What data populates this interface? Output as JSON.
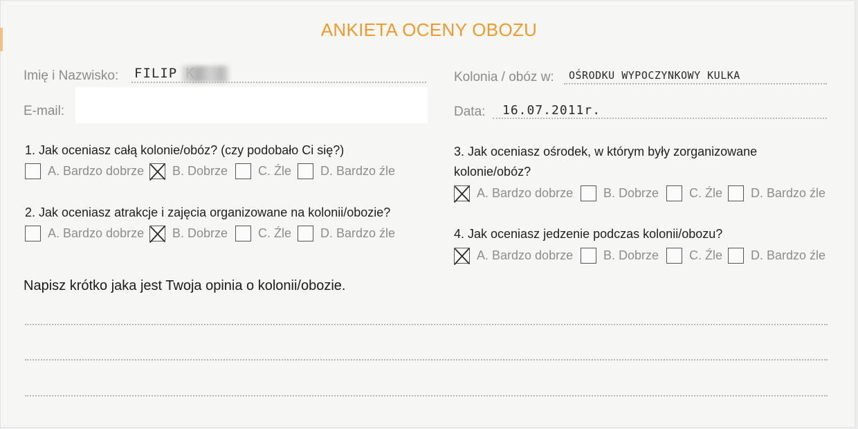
{
  "form": {
    "title": "ANKIETA OCENY OBOZU",
    "name_label": "Imię i Nazwisko:",
    "name_value": "FILIP K",
    "email_label": "E-mail:",
    "camp_label": "Kolonia / obóz w:",
    "camp_value": "OŚRODKU WYPOCZYNKOWY KULKA",
    "date_label": "Data:",
    "date_value": "16.07.2011r.",
    "options": [
      "A. Bardzo dobrze",
      "B. Dobrze",
      "C. Źle",
      "D. Bardzo źle"
    ],
    "questions": [
      {
        "text": "1. Jak oceniasz całą kolonie/obóz? (czy podobało Ci się?)",
        "checked": "B"
      },
      {
        "text": "2.  Jak oceniasz atrakcje i zajęcia organizowane na kolonii/obozie?",
        "checked": "B"
      },
      {
        "text": "3.  Jak oceniasz ośrodek, w którym były zorganizowane",
        "text2": "kolonie/obóz?",
        "checked": "A"
      },
      {
        "text": "4.  Jak oceniasz jedzenie podczas kolonii/obozu?",
        "checked": "A"
      }
    ],
    "opinion_prompt": "Napisz krótko jaka jest Twoja opinia o kolonii/obozie."
  }
}
